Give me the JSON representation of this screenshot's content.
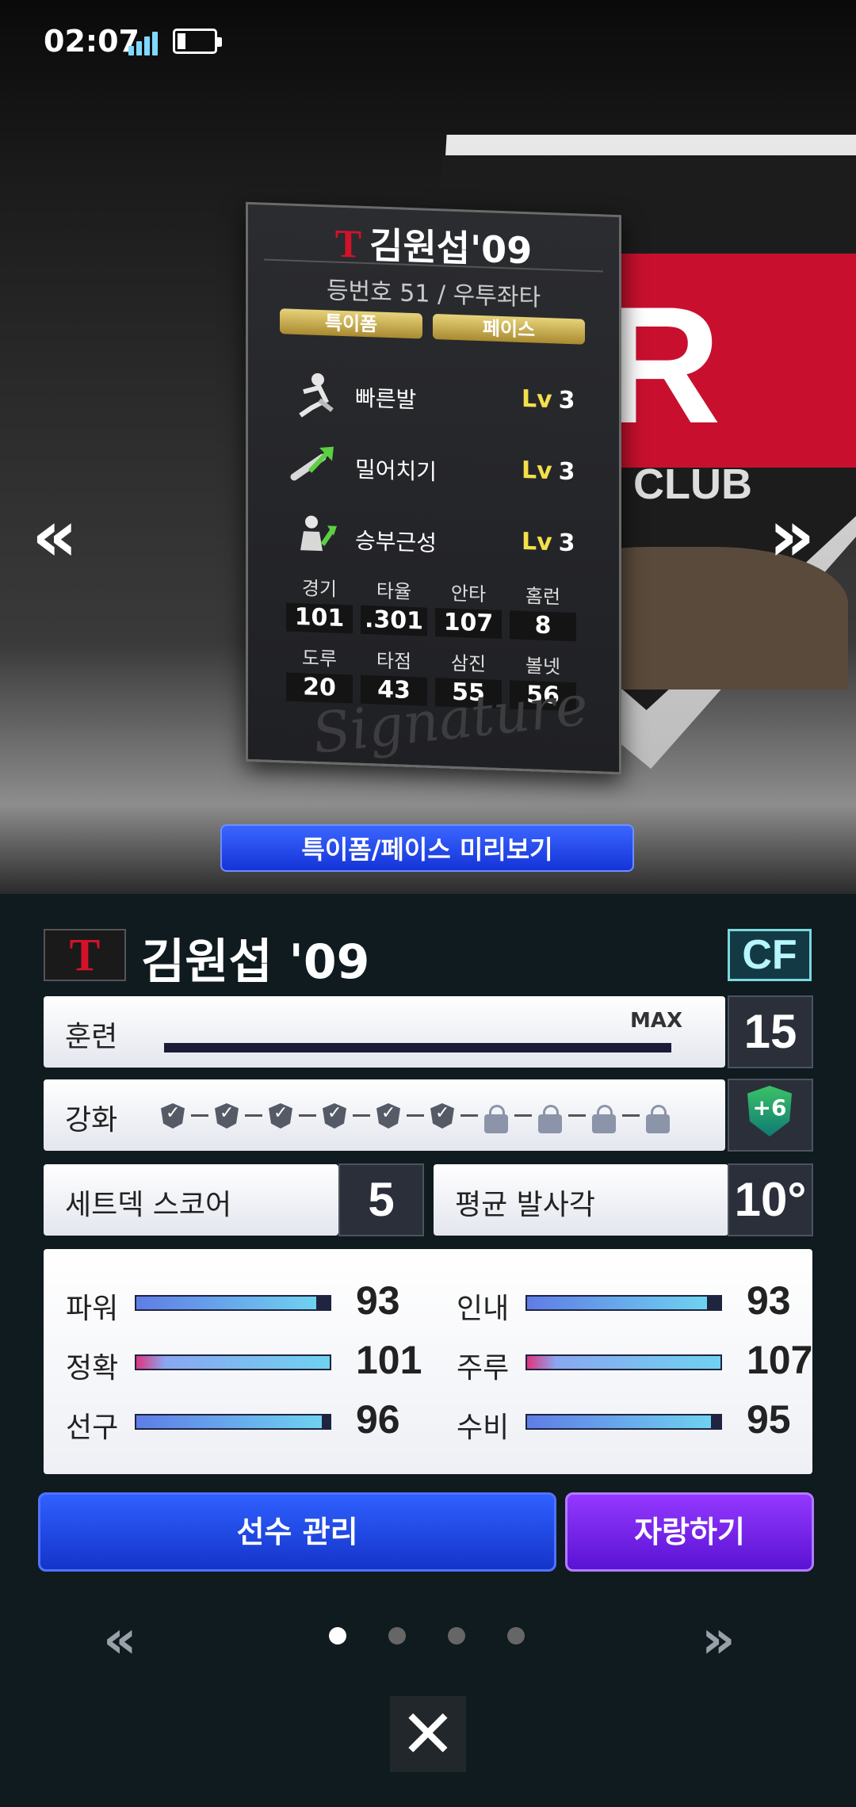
{
  "status": {
    "time": "02:07"
  },
  "card": {
    "team_mark": "T",
    "name": "김원섭'09",
    "info": "등번호 51 / 우투좌타",
    "pill1": "특이폼",
    "pill2": "페이스",
    "skills": [
      {
        "label": "빠른발",
        "lv_prefix": "Lv",
        "lv": "3",
        "icon": "running-icon"
      },
      {
        "label": "밀어치기",
        "lv_prefix": "Lv",
        "lv": "3",
        "icon": "bat-arrow-icon"
      },
      {
        "label": "승부근성",
        "lv_prefix": "Lv",
        "lv": "3",
        "icon": "batter-icon"
      }
    ],
    "stats": [
      {
        "k": "경기",
        "v": "101"
      },
      {
        "k": "타율",
        "v": ".301"
      },
      {
        "k": "안타",
        "v": "107"
      },
      {
        "k": "홈런",
        "v": "8"
      },
      {
        "k": "도루",
        "v": "20"
      },
      {
        "k": "타점",
        "v": "43"
      },
      {
        "k": "삼진",
        "v": "55"
      },
      {
        "k": "볼넷",
        "v": "56"
      }
    ],
    "signature": "Signature"
  },
  "emblem": {
    "main": "ER",
    "sub": "ALL CLUB"
  },
  "preview_button": "특이폼/페이스 미리보기",
  "player": {
    "team_mark": "T",
    "name": "김원섭 '09",
    "position": "CF"
  },
  "training": {
    "label": "훈련",
    "max_label": "MAX",
    "value": "15",
    "progress": 1.0
  },
  "enhance": {
    "label": "강화",
    "checked": 6,
    "locked": 4,
    "badge": "+6"
  },
  "setdeck": {
    "label": "세트덱 스코어",
    "value": "5"
  },
  "launch": {
    "label": "평균 발사각",
    "value": "10°"
  },
  "abilities": [
    {
      "label": "파워",
      "value": "93",
      "fill": 0.93,
      "pink": false
    },
    {
      "label": "인내",
      "value": "93",
      "fill": 0.93,
      "pink": false
    },
    {
      "label": "정확",
      "value": "101",
      "fill": 1.0,
      "pink": true
    },
    {
      "label": "주루",
      "value": "107",
      "fill": 1.0,
      "pink": true
    },
    {
      "label": "선구",
      "value": "96",
      "fill": 0.96,
      "pink": false
    },
    {
      "label": "수비",
      "value": "95",
      "fill": 0.95,
      "pink": false
    }
  ],
  "buttons": {
    "manage": "선수 관리",
    "brag": "자랑하기"
  },
  "nav": {
    "prev": "«",
    "next": "»",
    "close": "✕"
  },
  "colors": {
    "blue": "#1f4ff0",
    "purple": "#7a24f0",
    "accent_cyan": "#79d8dd",
    "team_red": "#d3122a"
  }
}
